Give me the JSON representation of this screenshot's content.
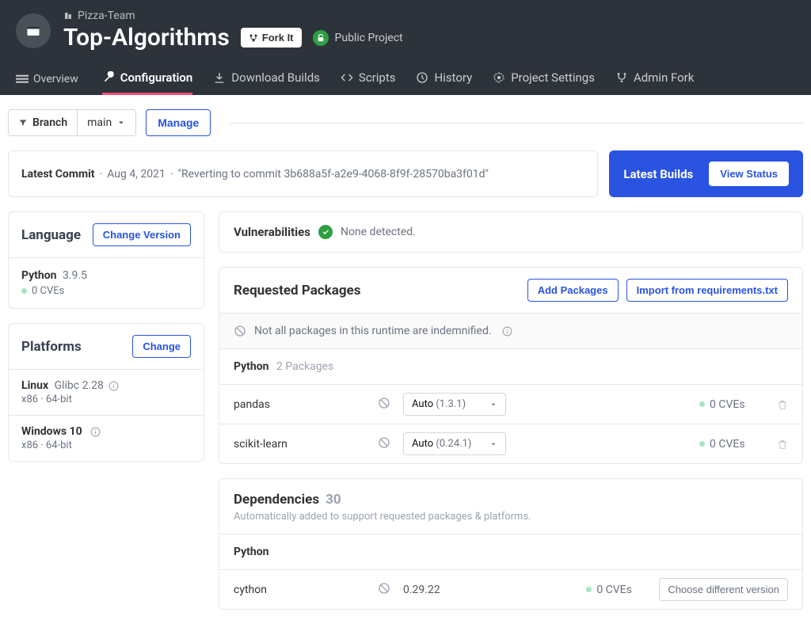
{
  "team": "Pizza-Team",
  "project": "Top-Algorithms",
  "fork_label": "Fork It",
  "visibility": "Public Project",
  "tabs": {
    "overview": "Overview",
    "configuration": "Configuration",
    "downloads": "Download Builds",
    "scripts": "Scripts",
    "history": "History",
    "settings": "Project Settings",
    "admin_fork": "Admin Fork"
  },
  "branch": {
    "label": "Branch",
    "current": "main",
    "manage": "Manage"
  },
  "commit": {
    "label": "Latest Commit",
    "date": "Aug 4, 2021",
    "message": "\"Reverting to commit 3b688a5f-a2e9-4068-8f9f-28570ba3f01d\""
  },
  "builds": {
    "label": "Latest Builds",
    "button": "View Status"
  },
  "language_card": {
    "title": "Language",
    "button": "Change Version",
    "name": "Python",
    "version": "3.9.5",
    "cves": "0 CVEs"
  },
  "platforms_card": {
    "title": "Platforms",
    "button": "Change",
    "items": [
      {
        "name": "Linux",
        "extra": "Glibc 2.28",
        "arch": "x86 · 64-bit"
      },
      {
        "name": "Windows 10",
        "extra": "",
        "arch": "x86 · 64-bit"
      }
    ]
  },
  "vuln": {
    "title": "Vulnerabilities",
    "status": "None detected."
  },
  "packages": {
    "title": "Requested Packages",
    "add_btn": "Add Packages",
    "import_btn": "Import from requirements.txt",
    "notice": "Not all packages in this runtime are indemnified.",
    "lang": "Python",
    "count": "2 Packages",
    "version_prefix": "Auto",
    "items": [
      {
        "name": "pandas",
        "version": "(1.3.1)",
        "cves": "0 CVEs"
      },
      {
        "name": "scikit-learn",
        "version": "(0.24.1)",
        "cves": "0 CVEs"
      }
    ]
  },
  "deps": {
    "title": "Dependencies",
    "count": "30",
    "sub": "Automatically added to support requested packages & platforms.",
    "lang": "Python",
    "choose_btn": "Choose different version",
    "items": [
      {
        "name": "cython",
        "version": "0.29.22",
        "cves": "0 CVEs"
      }
    ]
  }
}
